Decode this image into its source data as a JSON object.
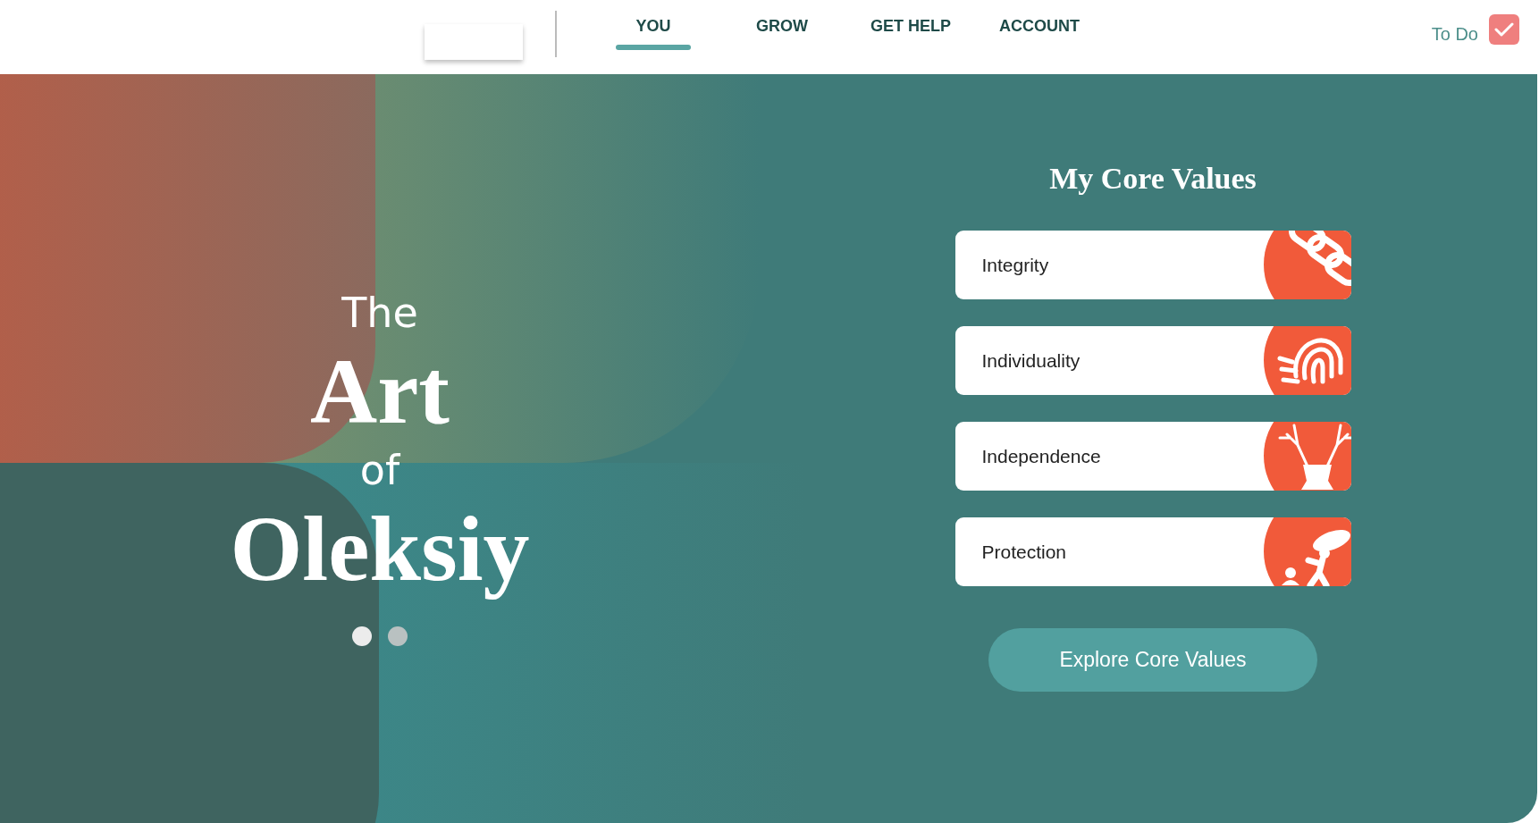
{
  "nav": {
    "tabs": [
      {
        "label": "YOU",
        "selected": true
      },
      {
        "label": "GROW",
        "selected": false
      },
      {
        "label": "GET HELP",
        "selected": false
      },
      {
        "label": "ACCOUNT",
        "selected": false
      }
    ],
    "todo": {
      "label": "To Do",
      "checked": true
    }
  },
  "hero": {
    "title_lines": [
      {
        "text": "The",
        "kind": "small"
      },
      {
        "text": "Art",
        "kind": "large"
      },
      {
        "text": "of",
        "kind": "small"
      },
      {
        "text": "Oleksiy",
        "kind": "large"
      }
    ],
    "dots": [
      {
        "selected": true
      },
      {
        "selected": false
      }
    ]
  },
  "core_values": {
    "heading": "My Core Values",
    "values": [
      {
        "label": "Integrity"
      },
      {
        "label": "Individuality"
      },
      {
        "label": "Independence"
      },
      {
        "label": "Protection"
      }
    ],
    "button": "Explore Core Values"
  }
}
